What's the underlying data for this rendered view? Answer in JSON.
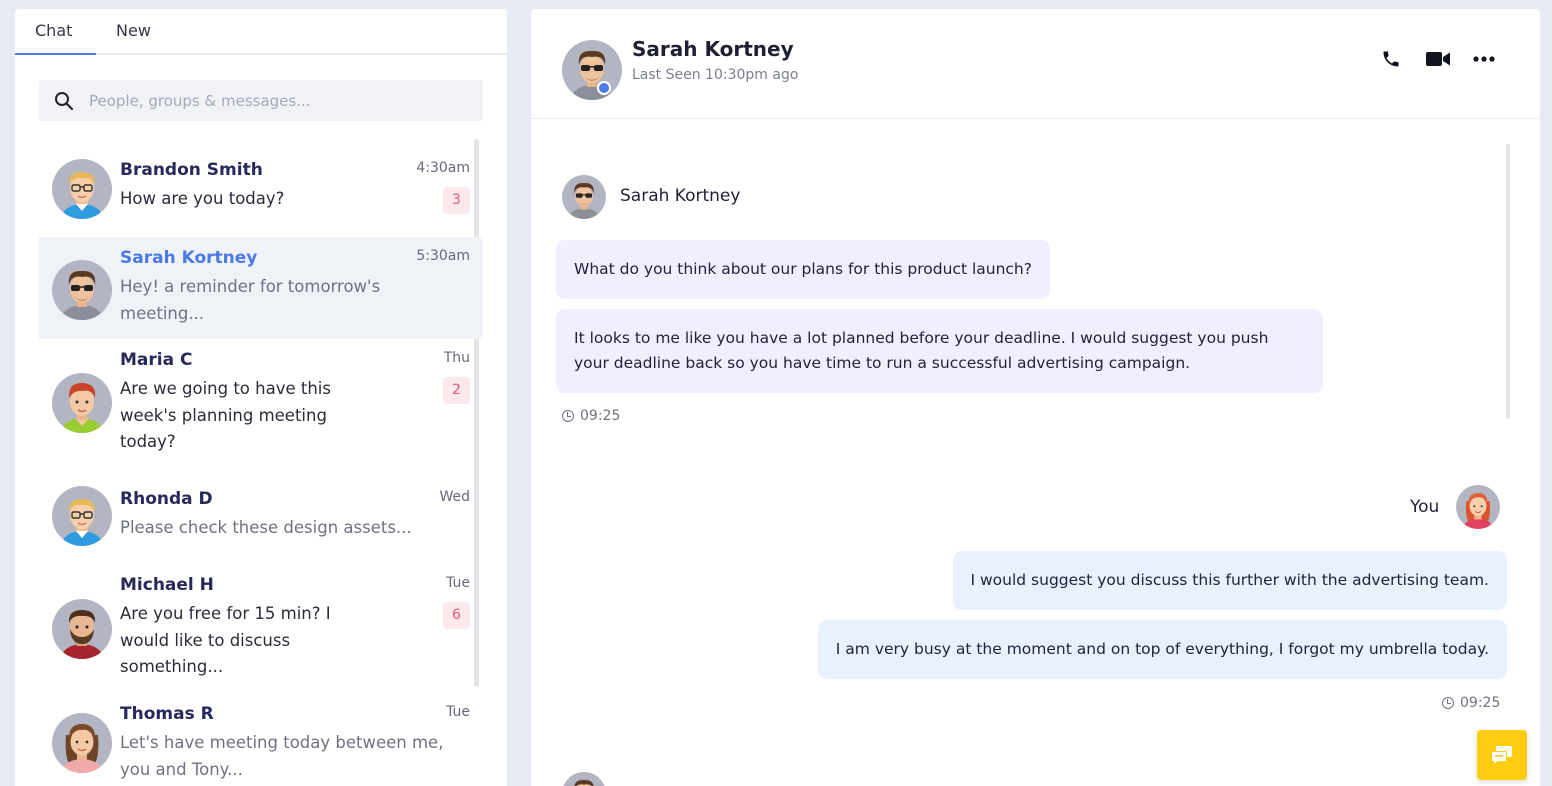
{
  "tabs": [
    {
      "label": "Chat",
      "active": true
    },
    {
      "label": "New",
      "active": false
    }
  ],
  "search": {
    "placeholder": "People, groups & messages..."
  },
  "conversations": [
    {
      "name": "Brandon Smith",
      "time": "4:30am",
      "message": "How are you today?",
      "unread": "3",
      "avatar": "man-glasses-blond"
    },
    {
      "name": "Sarah Kortney",
      "time": "5:30am",
      "message": "Hey! a reminder for tomorrow's meeting...",
      "active": true,
      "avatar": "man-sunglasses"
    },
    {
      "name": "Maria C",
      "time": "Thu",
      "message": "Are we going to have this week's planning meeting today?",
      "unread": "2",
      "avatar": "man-red-hair"
    },
    {
      "name": "Rhonda D",
      "time": "Wed",
      "message": "Please check these design assets...",
      "avatar": "man-glasses-blond"
    },
    {
      "name": "Michael H",
      "time": "Tue",
      "message": "Are you free for 15 min? I would like to discuss something...",
      "unread": "6",
      "avatar": "man-beard"
    },
    {
      "name": "Thomas R",
      "time": "Tue",
      "message": "Let's have meeting today between me, you and Tony...",
      "avatar": "woman-brown-hair"
    }
  ],
  "header": {
    "name": "Sarah Kortney",
    "status": "Last Seen 10:30pm ago",
    "icons": [
      "phone-icon",
      "video-icon",
      "more-icon"
    ]
  },
  "thread": {
    "incoming": {
      "sender": "Sarah Kortney",
      "messages": [
        "What do you think about our plans for this product launch?",
        "It looks to me like you have a lot planned before your deadline. I would suggest you push your deadline back so you have time to run a successful advertising campaign."
      ],
      "time": "09:25"
    },
    "outgoing": {
      "sender": "You",
      "messages": [
        "I would suggest you discuss this further with the advertising team.",
        "I am very busy at the moment and on top of everything, I forgot my umbrella today."
      ],
      "time": "09:25"
    }
  },
  "colors": {
    "accent": "#4e79e6",
    "badge_bg": "#fde8ec",
    "badge_text": "#e35b74",
    "incoming_bubble": "#f1efff",
    "outgoing_bubble": "#e9f1ff",
    "fab": "#fdcb10"
  }
}
